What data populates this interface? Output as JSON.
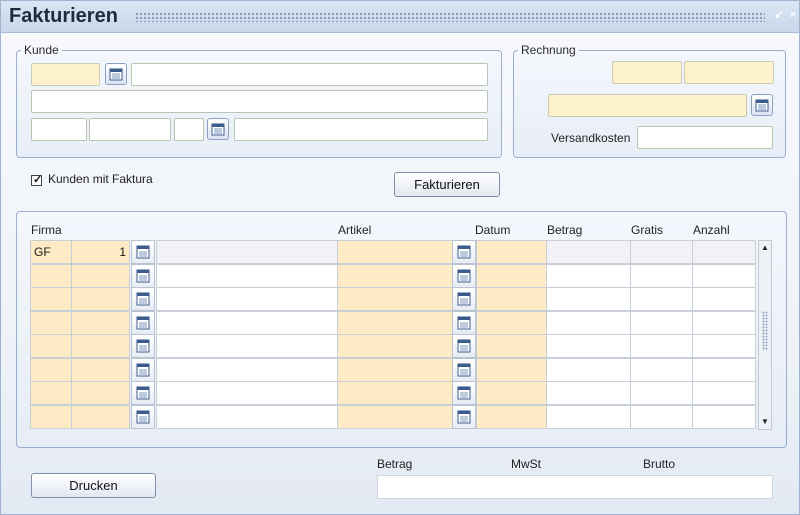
{
  "window": {
    "title": "Fakturieren"
  },
  "kunde": {
    "legend": "Kunde",
    "fields": [
      "",
      "",
      "",
      "",
      "",
      "",
      ""
    ]
  },
  "rechnung": {
    "legend": "Rechnung",
    "versandkosten_label": "Versandkosten",
    "fields": [
      "",
      "",
      "",
      ""
    ]
  },
  "options": {
    "kunden_mit_faktura_label": "Kunden mit Faktura",
    "kunden_mit_faktura_checked": true
  },
  "actions": {
    "fakturieren_label": "Fakturieren",
    "drucken_label": "Drucken"
  },
  "grid": {
    "columns": {
      "firma": "Firma",
      "artikel": "Artikel",
      "datum": "Datum",
      "betrag": "Betrag",
      "gratis": "Gratis",
      "anzahl": "Anzahl"
    },
    "rows": [
      {
        "firma": "GF",
        "nr": "1"
      },
      {
        "firma": "",
        "nr": ""
      },
      {
        "firma": "",
        "nr": ""
      },
      {
        "firma": "",
        "nr": ""
      },
      {
        "firma": "",
        "nr": ""
      },
      {
        "firma": "",
        "nr": ""
      },
      {
        "firma": "",
        "nr": ""
      },
      {
        "firma": "",
        "nr": ""
      }
    ]
  },
  "totals": {
    "betrag_label": "Betrag",
    "mwst_label": "MwSt",
    "brutto_label": "Brutto"
  },
  "colors": {
    "field_yellow": "#fef2cc",
    "panel_border": "#9aaed0"
  }
}
